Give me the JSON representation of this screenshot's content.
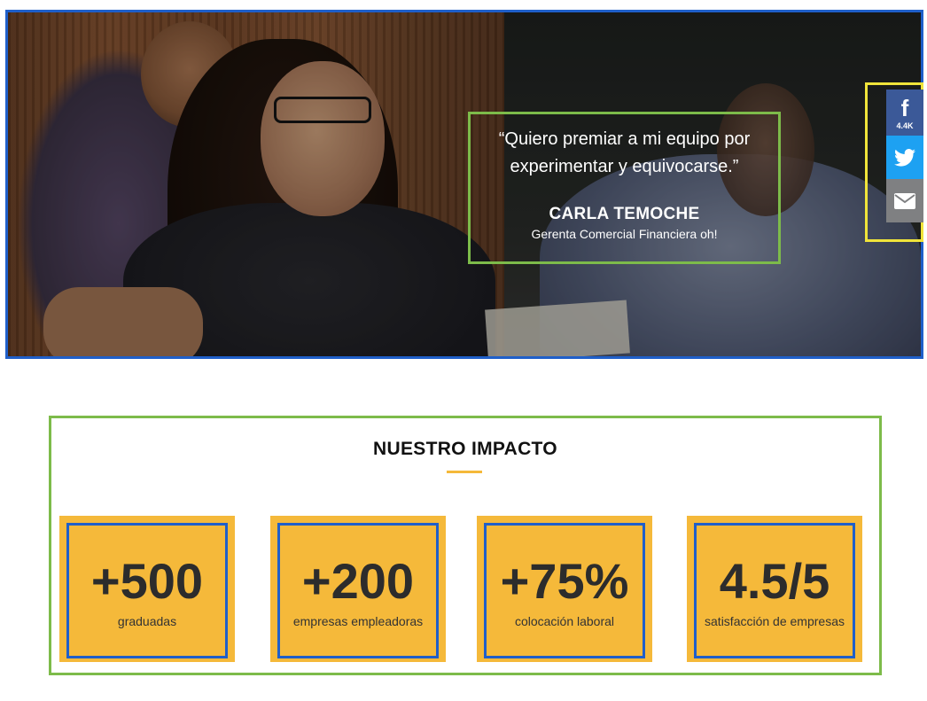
{
  "hero": {
    "quote": "“Quiero premiar a mi equipo por experimentar y equivocarse.”",
    "name": "CARLA TEMOCHE",
    "role": "Gerenta Comercial Financiera oh!"
  },
  "share": {
    "facebook_icon": "facebook-icon",
    "facebook_glyph": "f",
    "facebook_count": "4.4K",
    "twitter_icon": "twitter-icon",
    "email_icon": "email-icon",
    "colors": {
      "facebook": "#3b5998",
      "twitter": "#1da1f2",
      "email": "#7f8082"
    }
  },
  "impact": {
    "title": "NUESTRO IMPACTO",
    "accent_color": "#f5b93a",
    "stats": [
      {
        "value": "+500",
        "label": "graduadas"
      },
      {
        "value": "+200",
        "label": "empresas empleadoras"
      },
      {
        "value": "+75%",
        "label": "colocación laboral"
      },
      {
        "value": "4.5/5",
        "label": "satisfacción de empresas"
      }
    ]
  }
}
